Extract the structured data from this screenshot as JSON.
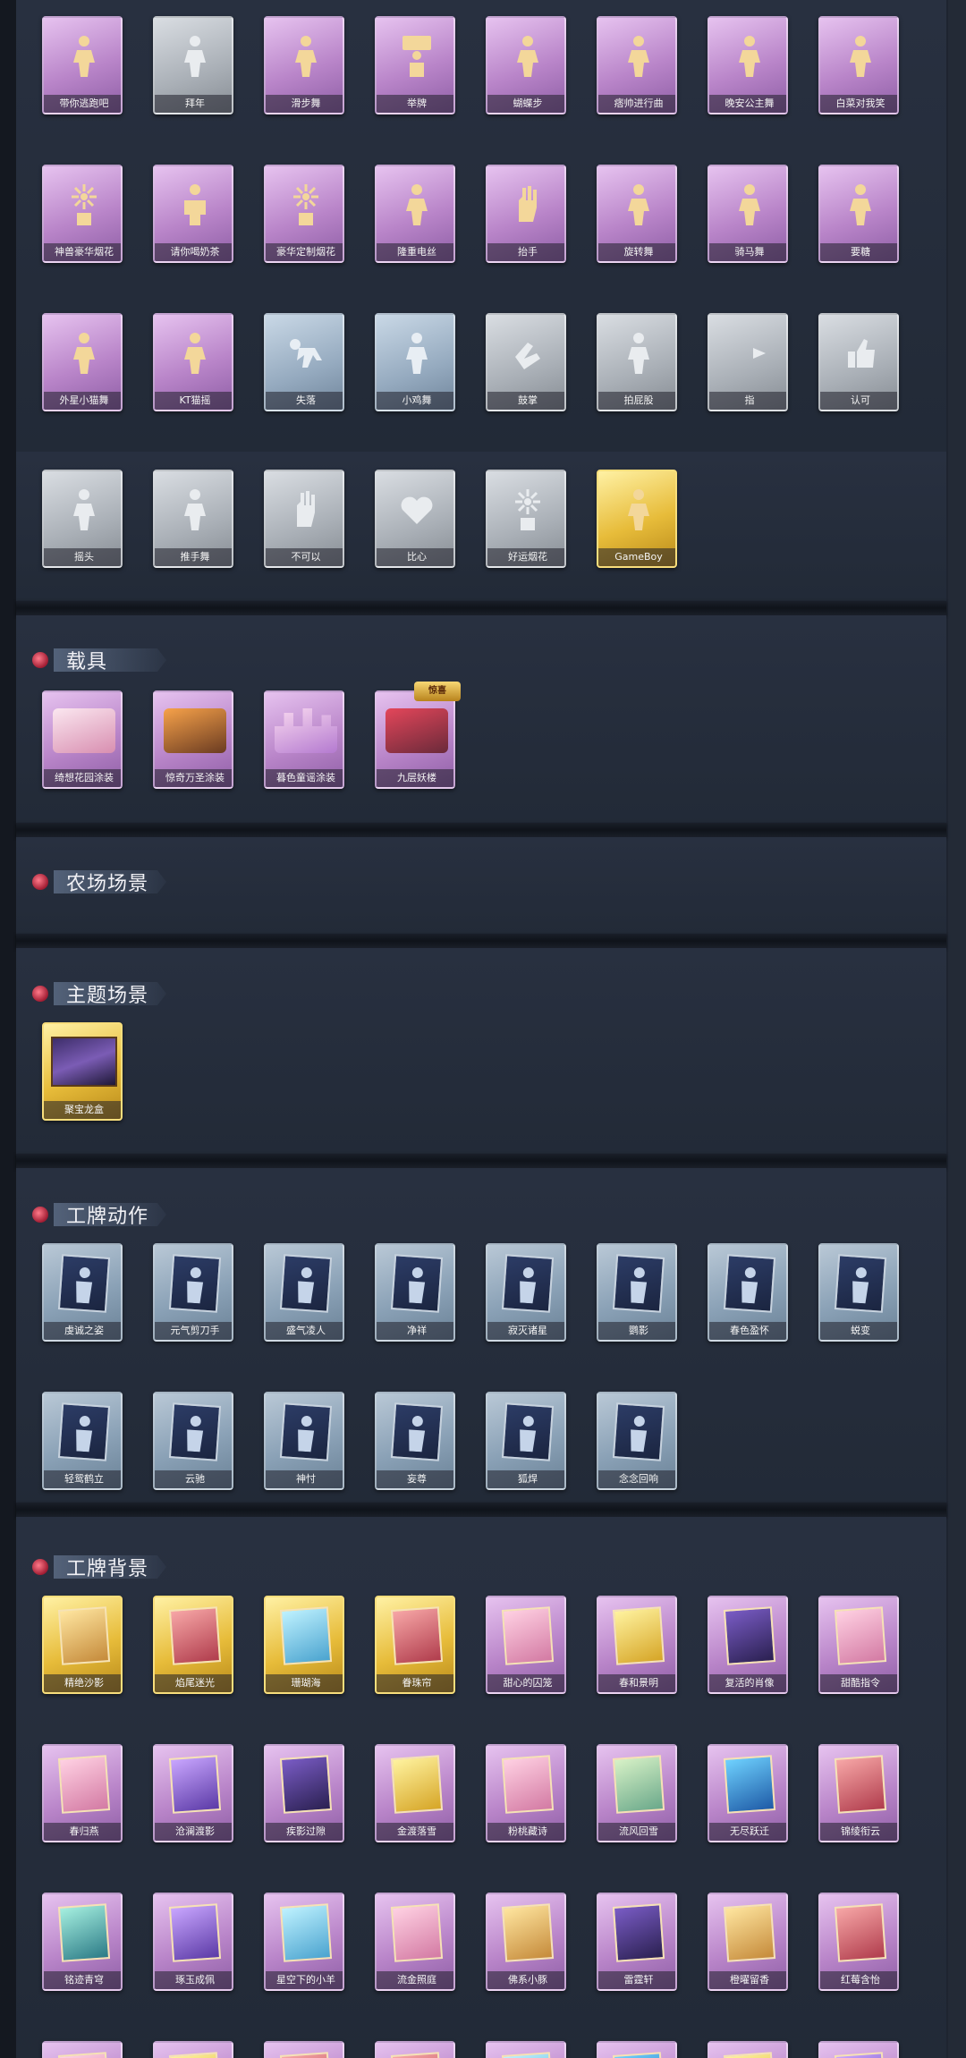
{
  "sections": {
    "vehicles": {
      "title": "载具"
    },
    "farm": {
      "title": "农场场景"
    },
    "theme": {
      "title": "主题场景"
    },
    "badge_actions": {
      "title": "工牌动作"
    },
    "badge_backgrounds": {
      "title": "工牌背景"
    }
  },
  "actions_top": [
    "带你逃跑吧",
    "拜年",
    "滑步舞",
    "举牌",
    "蝴蝶步",
    "痞帅进行曲",
    "晚安公主舞",
    "白菜对我笑",
    "神兽豪华烟花",
    "请你喝奶茶",
    "豪华定制烟花",
    "隆重电丝",
    "抬手",
    "旋转舞",
    "骑马舞",
    "要糖",
    "外星小猫舞",
    "KT猫摇",
    "失落",
    "小鸡舞",
    "鼓掌",
    "拍屁股",
    "指",
    "认可"
  ],
  "actions_row4": [
    "摇头",
    "推手舞",
    "不可以",
    "比心",
    "好运烟花",
    "GameBoy"
  ],
  "vehicles": [
    "绮想花园涂装",
    "惊奇万圣涂装",
    "暮色童谣涂装",
    "九层妖楼"
  ],
  "vehicle_badge": "惊喜",
  "themes": [
    "聚宝龙盒"
  ],
  "badge_actions": [
    "虔诚之姿",
    "元气剪刀手",
    "盛气凌人",
    "净祥",
    "寂灭诸星",
    "鹦影",
    "春色盈怀",
    "蜕变",
    "轻鸳鹤立",
    "云驰",
    "神忖",
    "妄尊",
    "狐焊",
    "念念回响"
  ],
  "badge_backgrounds": [
    "精绝沙影",
    "焰尾迷光",
    "珊瑚海",
    "眷珠帘",
    "甜心的囚笼",
    "春和景明",
    "复活的肖像",
    "甜酷指令",
    "春归燕",
    "沧澜渡影",
    "疾影过隙",
    "金渡落雪",
    "粉桃藏诗",
    "流风回雪",
    "无尽跃迁",
    "锦绫衔云",
    "铭迹青穹",
    "琢玉成佩",
    "星空下的小羊",
    "流金照庭",
    "佛系小豚",
    "雷霆轩",
    "橙曜留香",
    "红莓含怡",
    "",
    "",
    "",
    "",
    "",
    "",
    "",
    ""
  ]
}
